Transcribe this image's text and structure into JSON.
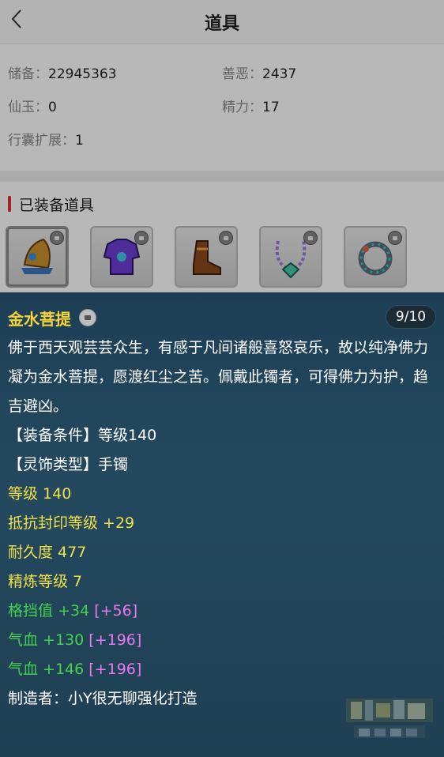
{
  "nav": {
    "title": "道具"
  },
  "stats": {
    "row1": {
      "a_label": "储备：",
      "a_value": "22945363",
      "b_label": "善恶：",
      "b_value": "2437"
    },
    "row2": {
      "a_label": "仙玉：",
      "a_value": "0",
      "b_label": "精力：",
      "b_value": "17"
    },
    "row3": {
      "a_label": "行囊扩展：",
      "a_value": "1"
    }
  },
  "equipped": {
    "header": "已装备道具",
    "slots": [
      {
        "icon": "helmet-icon"
      },
      {
        "icon": "armor-icon"
      },
      {
        "icon": "boots-icon"
      },
      {
        "icon": "necklace-icon"
      },
      {
        "icon": "bracelet-icon"
      }
    ]
  },
  "item": {
    "name": "金水菩提",
    "count": "9/10",
    "desc": "佛于西天观芸芸众生，有感于凡间诸般喜怒哀乐，故以纯净佛力凝为金水菩提，愿渡红尘之苦。佩戴此镯者，可得佛力为护，趋吉避凶。",
    "cond": "【装备条件】等级140",
    "type": "【灵饰类型】手镯",
    "level": "等级 140",
    "resist": "抵抗封印等级 +29",
    "durability": "耐久度 477",
    "refine": "精炼等级 7",
    "block": "格挡值 +34",
    "block_bonus": "[+56]",
    "hp1": "气血 +130",
    "hp1_bonus": "[+196]",
    "hp2": "气血 +146",
    "hp2_bonus": "[+196]",
    "maker": "制造者：小Y很无聊强化打造"
  },
  "colors": {
    "name": "#f5d33a",
    "yellow": "#f0e04a",
    "green": "#43d24d",
    "pink": "#e879f0",
    "panel": "#24495f",
    "accent_bar": "#dd3333"
  }
}
